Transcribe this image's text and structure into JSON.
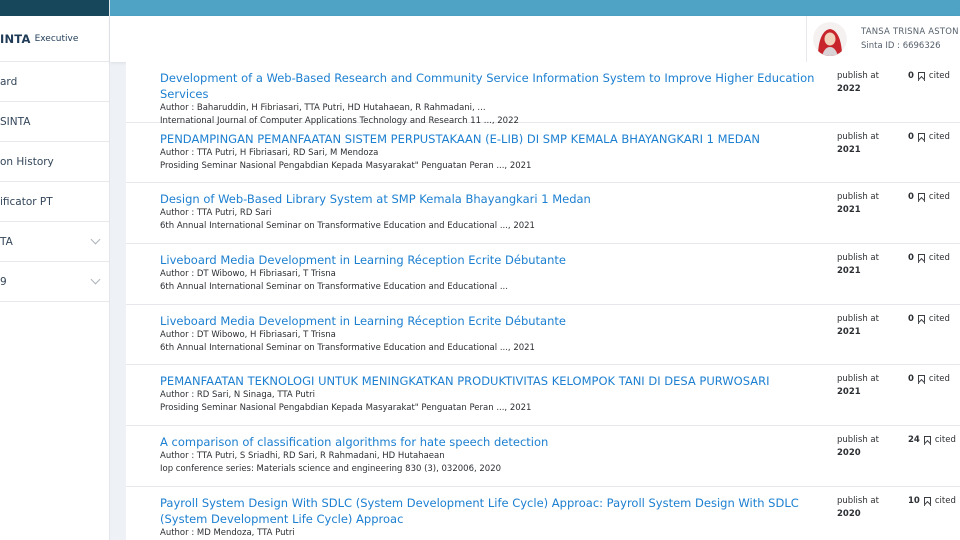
{
  "brand": {
    "name": "INTA",
    "sub": "Executive"
  },
  "sidebar": {
    "items": [
      {
        "label": "ard",
        "chevron": false
      },
      {
        "label": " SINTA",
        "chevron": false
      },
      {
        "label": "on History",
        "chevron": false
      },
      {
        "label": "ificator PT",
        "chevron": false
      },
      {
        "label": "TA",
        "chevron": true
      },
      {
        "label": "9",
        "chevron": true
      }
    ]
  },
  "user": {
    "name": "TANSA TRISNA ASTON",
    "sinta_id": "Sinta ID : 6696326"
  },
  "publications": [
    {
      "title": "Development of a Web-Based Research and Community Service Information System to Improve Higher Education Services",
      "authors": "Author : Baharuddin, H Fibriasari, TTA Putri, HD Hutahaean, R Rahmadani, ...",
      "venue": "International Journal of Computer Applications Technology and Research 11 ..., 2022",
      "publish_label": "publish at",
      "year": "2022",
      "cited_count": "0",
      "cited_label": "cited"
    },
    {
      "title": "PENDAMPINGAN PEMANFAATAN SISTEM PERPUSTAKAAN (E-LIB) DI SMP KEMALA BHAYANGKARI 1 MEDAN",
      "authors": "Author : TTA Putri, H Fibriasari, RD Sari, M Mendoza",
      "venue": "Prosiding Seminar Nasional Pengabdian Kepada Masyarakat\" Penguatan Peran ..., 2021",
      "publish_label": "publish at",
      "year": "2021",
      "cited_count": "0",
      "cited_label": "cited"
    },
    {
      "title": "Design of Web-Based Library System at SMP Kemala Bhayangkari 1 Medan",
      "authors": "Author : TTA Putri, RD Sari",
      "venue": "6th Annual International Seminar on Transformative Education and Educational ..., 2021",
      "publish_label": "publish at",
      "year": "2021",
      "cited_count": "0",
      "cited_label": "cited"
    },
    {
      "title": "Liveboard Media Development in Learning Réception Ecrite Débutante",
      "authors": "Author : DT Wibowo, H Fibriasari, T Trisna",
      "venue": "6th Annual International Seminar on Transformative Education and Educational ...",
      "publish_label": "publish at",
      "year": "2021",
      "cited_count": "0",
      "cited_label": "cited"
    },
    {
      "title": "Liveboard Media Development in Learning Réception Ecrite Débutante",
      "authors": "Author : DT Wibowo, H Fibriasari, T Trisna",
      "venue": "6th Annual International Seminar on Transformative Education and Educational ..., 2021",
      "publish_label": "publish at",
      "year": "2021",
      "cited_count": "0",
      "cited_label": "cited"
    },
    {
      "title": "PEMANFAATAN TEKNOLOGI UNTUK MENINGKATKAN PRODUKTIVITAS KELOMPOK TANI DI DESA PURWOSARI",
      "authors": "Author : RD Sari, N Sinaga, TTA Putri",
      "venue": "Prosiding Seminar Nasional Pengabdian Kepada Masyarakat\" Penguatan Peran ..., 2021",
      "publish_label": "publish at",
      "year": "2021",
      "cited_count": "0",
      "cited_label": "cited"
    },
    {
      "title": "A comparison of classification algorithms for hate speech detection",
      "authors": "Author : TTA Putri, S Sriadhi, RD Sari, R Rahmadani, HD Hutahaean",
      "venue": "Iop conference series: Materials science and engineering 830 (3), 032006, 2020",
      "publish_label": "publish at",
      "year": "2020",
      "cited_count": "24",
      "cited_label": "cited"
    },
    {
      "title": "Payroll System Design With SDLC (System Development Life Cycle) Approac: Payroll System Design With SDLC (System Development Life Cycle) Approac",
      "authors": "Author : MD Mendoza, TTA Putri",
      "venue": "",
      "publish_label": "publish at",
      "year": "2020",
      "cited_count": "10",
      "cited_label": "cited"
    }
  ],
  "colors": {
    "sidebar_top": "#16475b",
    "topbar": "#4fa3c4",
    "link": "#1c7fd0"
  },
  "icons": {
    "cited": "bookmark-icon",
    "nav_expand": "chevron-down-icon"
  }
}
